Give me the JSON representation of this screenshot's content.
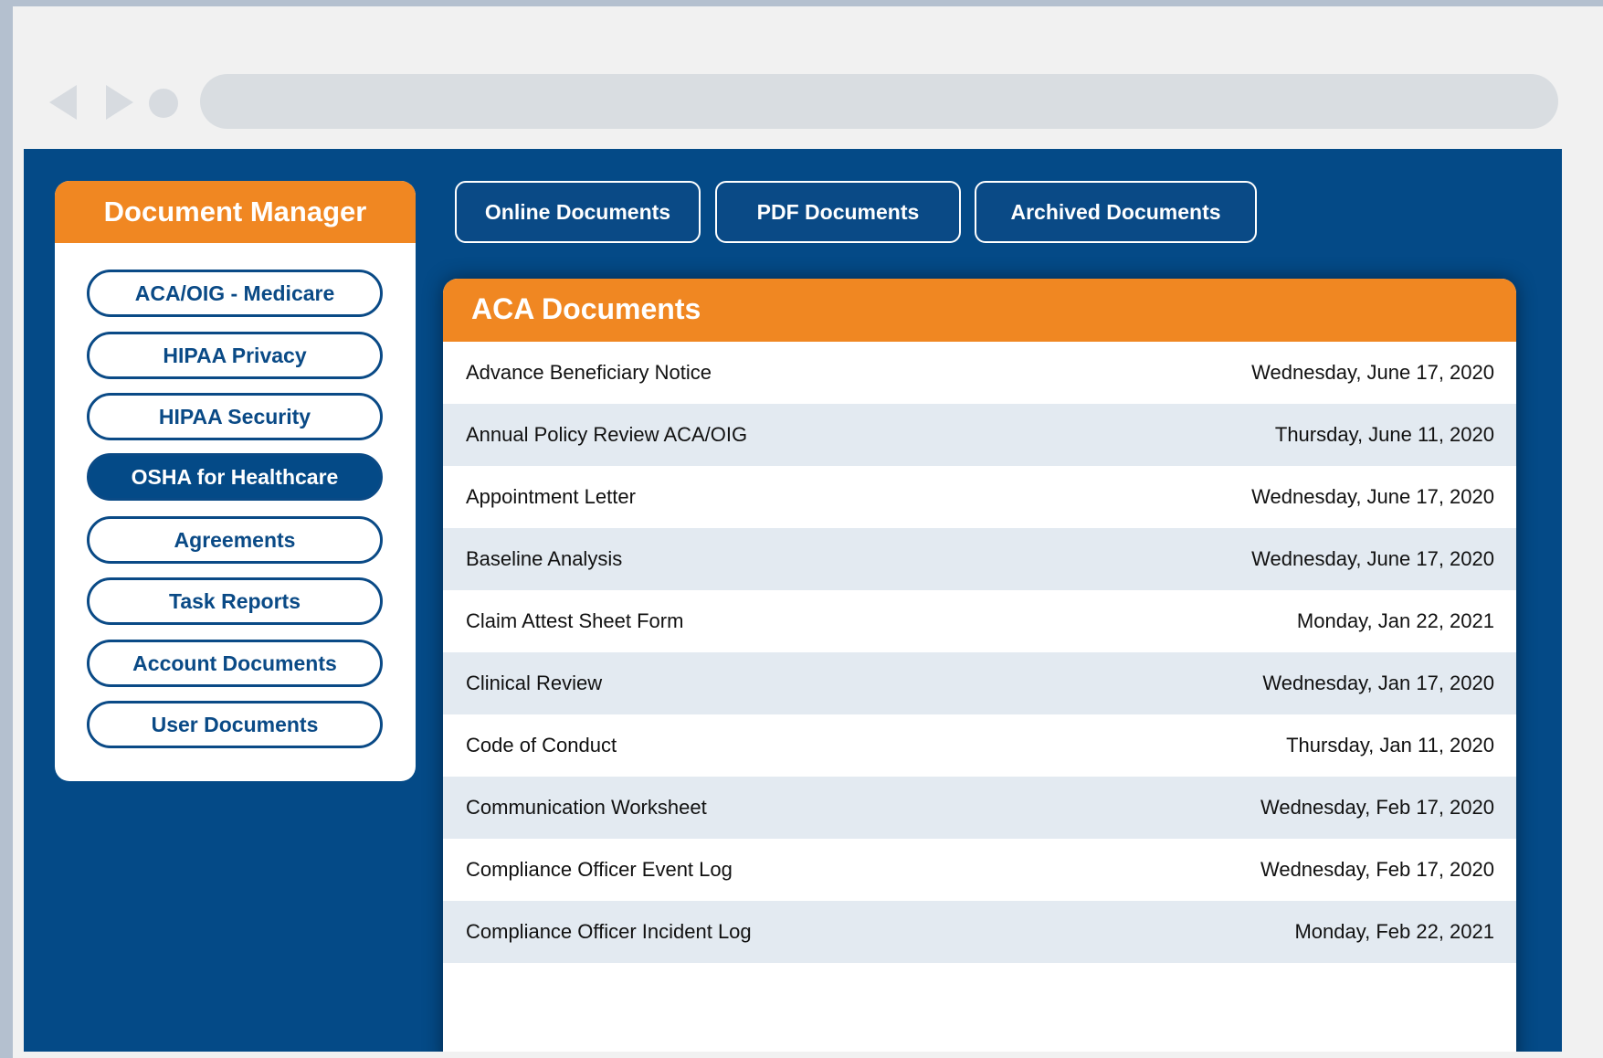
{
  "sidebar": {
    "title": "Document Manager",
    "items": [
      {
        "label": "ACA/OIG - Medicare",
        "active": false
      },
      {
        "label": "HIPAA Privacy",
        "active": false
      },
      {
        "label": "HIPAA Security",
        "active": false
      },
      {
        "label": "OSHA for Healthcare",
        "active": true
      },
      {
        "label": "Agreements",
        "active": false
      },
      {
        "label": "Task Reports",
        "active": false
      },
      {
        "label": "Account Documents",
        "active": false
      },
      {
        "label": "User Documents",
        "active": false
      }
    ]
  },
  "tabs": [
    {
      "label": "Online Documents"
    },
    {
      "label": "PDF Documents"
    },
    {
      "label": "Archived Documents"
    }
  ],
  "panel": {
    "title": "ACA Documents",
    "documents": [
      {
        "name": "Advance Beneficiary Notice",
        "date": "Wednesday, June 17, 2020"
      },
      {
        "name": "Annual Policy Review ACA/OIG",
        "date": "Thursday, June 11, 2020"
      },
      {
        "name": "Appointment Letter",
        "date": "Wednesday, June 17, 2020"
      },
      {
        "name": "Baseline Analysis",
        "date": "Wednesday, June 17, 2020"
      },
      {
        "name": "Claim Attest Sheet Form",
        "date": "Monday, Jan 22, 2021"
      },
      {
        "name": "Clinical Review",
        "date": "Wednesday, Jan 17, 2020"
      },
      {
        "name": "Code of Conduct",
        "date": "Thursday, Jan 11, 2020"
      },
      {
        "name": "Communication Worksheet",
        "date": "Wednesday, Feb 17, 2020"
      },
      {
        "name": "Compliance Officer Event Log",
        "date": "Wednesday, Feb 17, 2020"
      },
      {
        "name": "Compliance Officer Incident Log",
        "date": "Monday, Feb 22, 2021"
      }
    ]
  },
  "colors": {
    "brand_blue": "#044a87",
    "accent_orange": "#f08722",
    "row_alt": "#e3eaf1"
  },
  "icons": [
    "back-arrow-icon",
    "forward-arrow-icon",
    "reload-dot-icon"
  ]
}
